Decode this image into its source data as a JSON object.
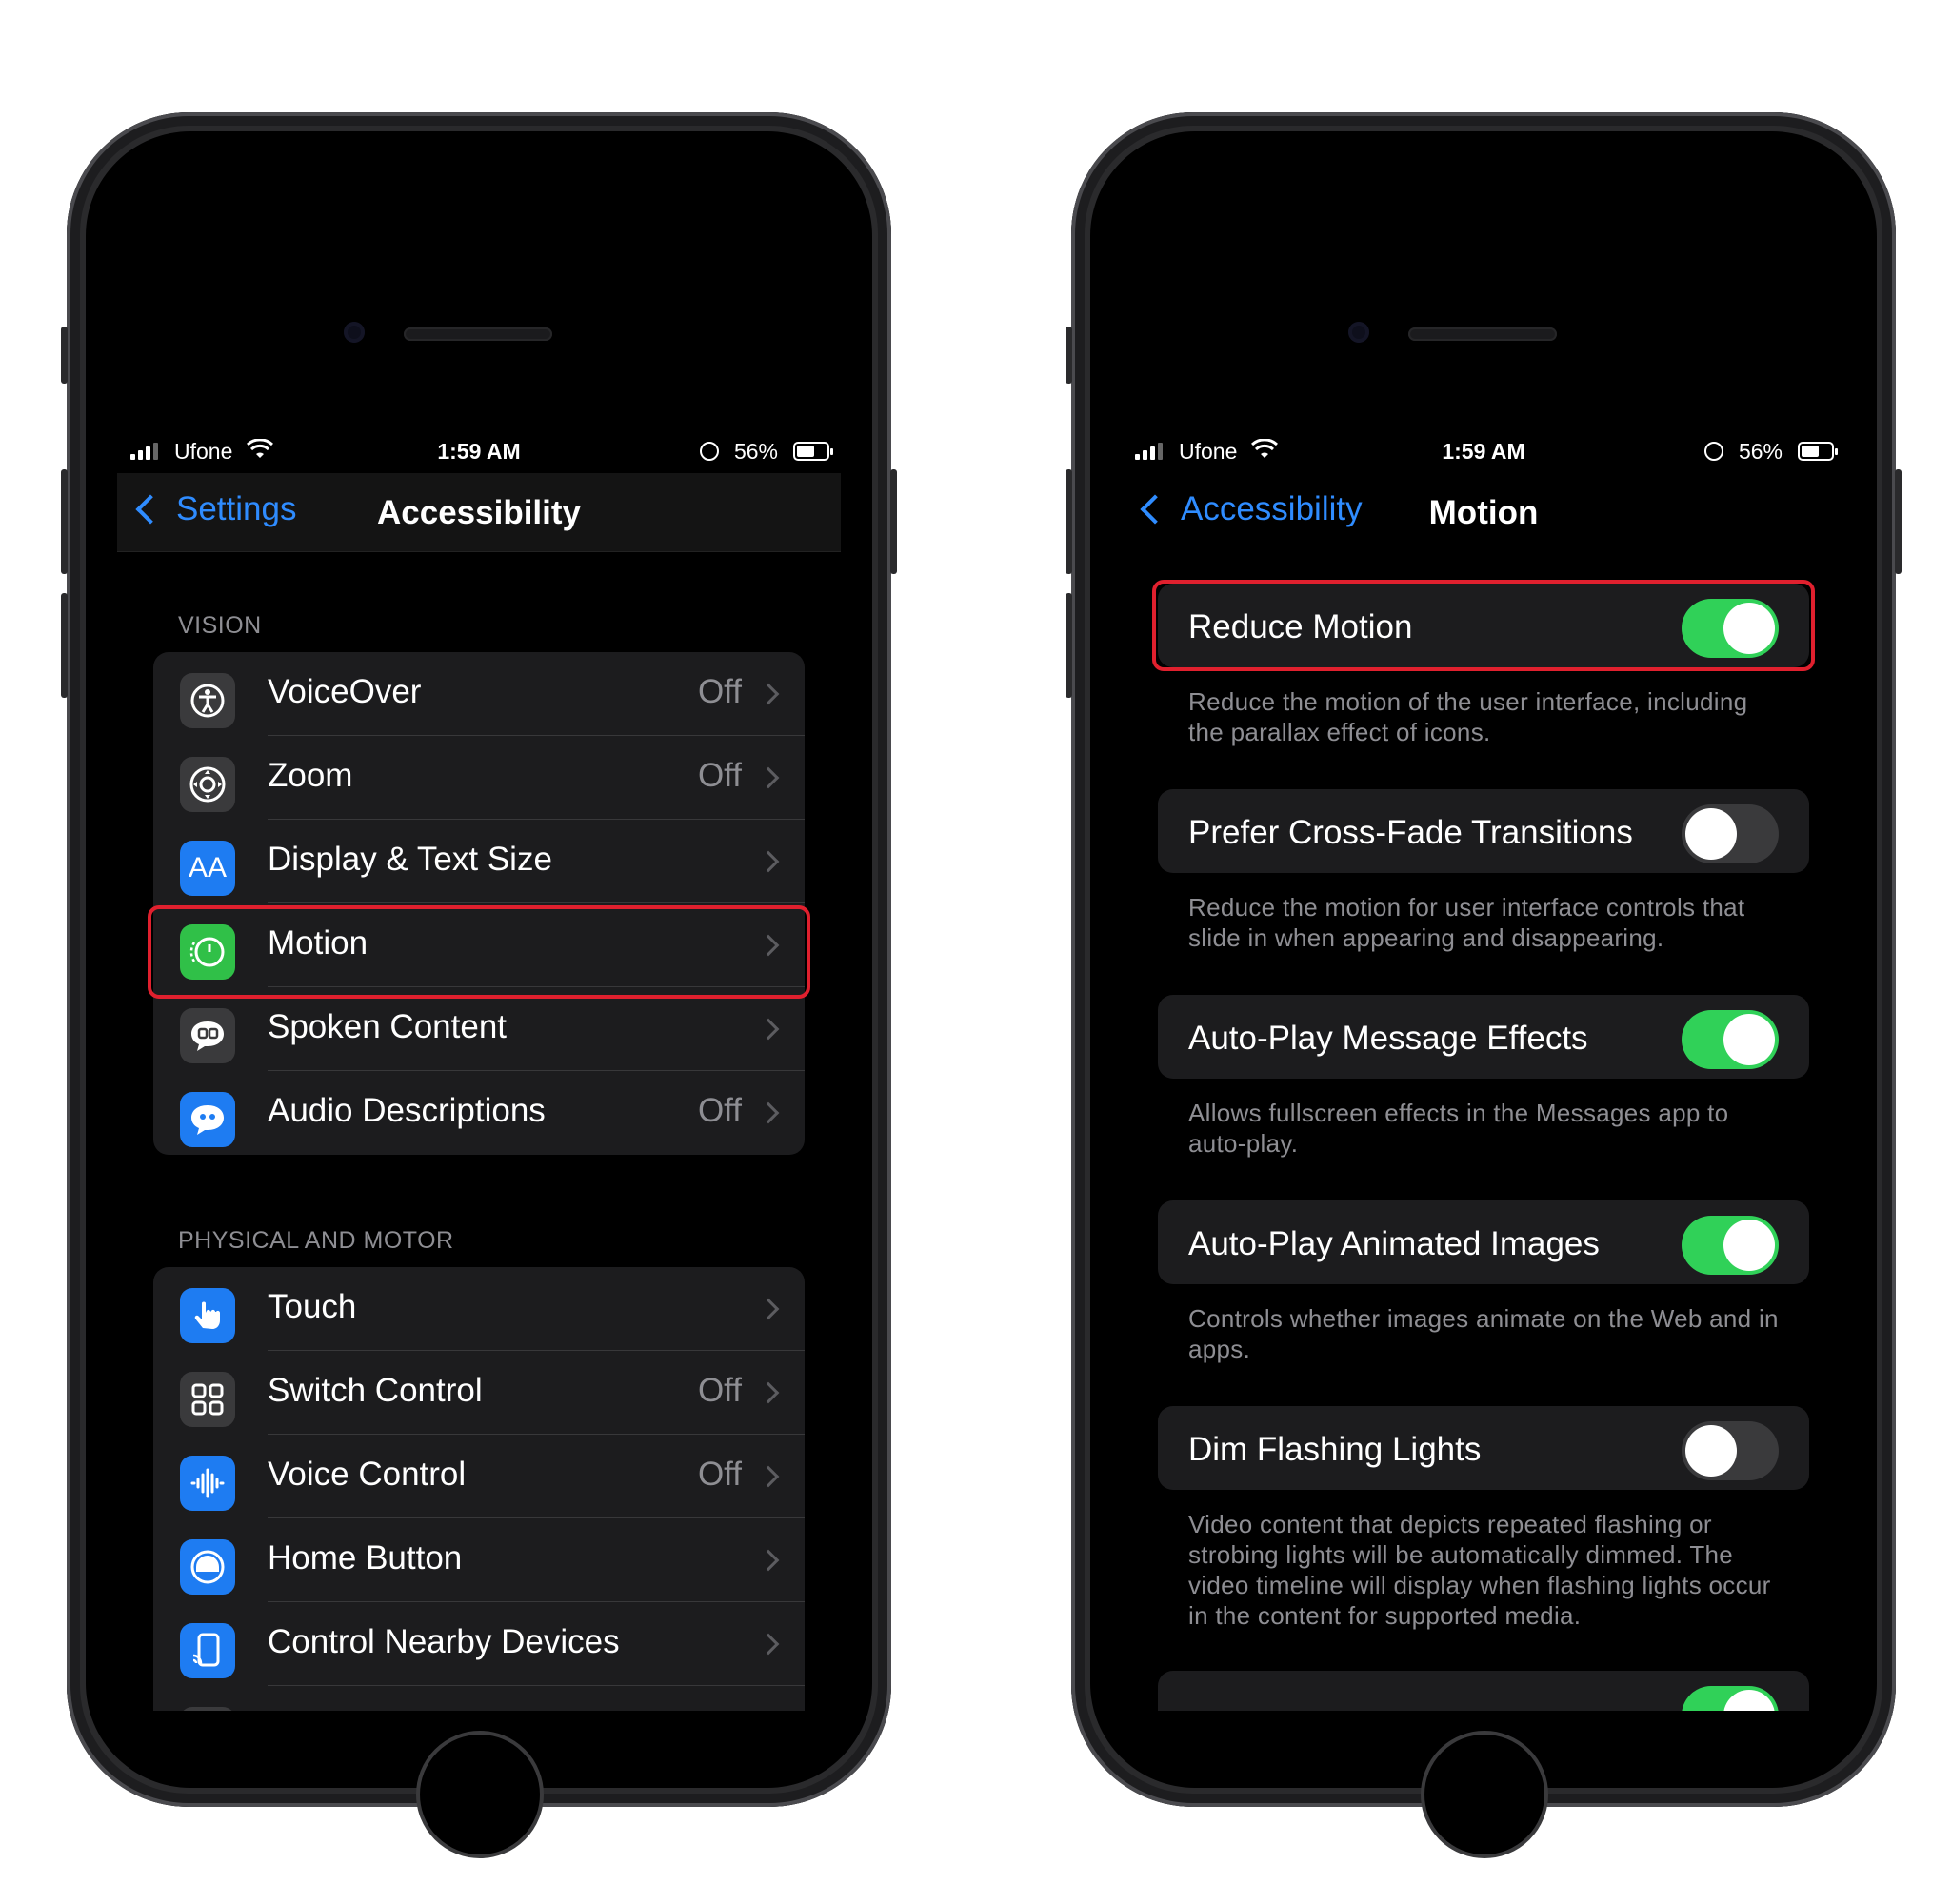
{
  "status": {
    "carrier": "Ufone",
    "time": "1:59 AM",
    "battery_pct": "56%"
  },
  "left": {
    "nav": {
      "back_label": "Settings",
      "title": "Accessibility"
    },
    "vision_header": "VISION",
    "vision_items": [
      {
        "label": "VoiceOver",
        "value": "Off",
        "icon": "voiceover-icon",
        "color": "#3a3a3c"
      },
      {
        "label": "Zoom",
        "value": "Off",
        "icon": "zoom-icon",
        "color": "#3a3a3c"
      },
      {
        "label": "Display & Text Size",
        "value": "",
        "icon": "text-size-icon",
        "color": "#1e7cf2"
      },
      {
        "label": "Motion",
        "value": "",
        "icon": "motion-icon",
        "color": "#30c048"
      },
      {
        "label": "Spoken Content",
        "value": "",
        "icon": "speech-bubble-icon",
        "color": "#3a3a3c"
      },
      {
        "label": "Audio Descriptions",
        "value": "Off",
        "icon": "audio-description-icon",
        "color": "#1e7cf2"
      }
    ],
    "physical_header": "PHYSICAL AND MOTOR",
    "physical_items": [
      {
        "label": "Touch",
        "value": "",
        "icon": "hand-icon",
        "color": "#1e7cf2"
      },
      {
        "label": "Switch Control",
        "value": "Off",
        "icon": "grid-icon",
        "color": "#3a3a3c"
      },
      {
        "label": "Voice Control",
        "value": "Off",
        "icon": "waveform-icon",
        "color": "#1e7cf2"
      },
      {
        "label": "Home Button",
        "value": "",
        "icon": "home-button-icon",
        "color": "#1e7cf2"
      },
      {
        "label": "Control Nearby Devices",
        "value": "",
        "icon": "device-icon",
        "color": "#1e7cf2"
      }
    ]
  },
  "right": {
    "nav": {
      "back_label": "Accessibility",
      "title": "Motion"
    },
    "settings": [
      {
        "label": "Reduce Motion",
        "on": true,
        "desc": "Reduce the motion of the user interface, including the parallax effect of icons."
      },
      {
        "label": "Prefer Cross-Fade Transitions",
        "on": false,
        "desc": "Reduce the motion for user interface controls that slide in when appearing and disappearing."
      },
      {
        "label": "Auto-Play Message Effects",
        "on": true,
        "desc": "Allows fullscreen effects in the Messages app to auto-play."
      },
      {
        "label": "Auto-Play Animated Images",
        "on": true,
        "desc": "Controls whether images animate on the Web and in apps."
      },
      {
        "label": "Dim Flashing Lights",
        "on": false,
        "desc": "Video content that depicts repeated flashing or strobing lights will be automatically dimmed. The video timeline will display when flashing lights occur in the content for supported media."
      }
    ]
  },
  "colors": {
    "accent": "#2f8cff",
    "toggle_on": "#30d158",
    "highlight": "#e0202e"
  }
}
